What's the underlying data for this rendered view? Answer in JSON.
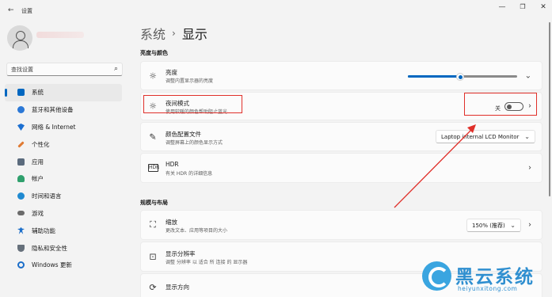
{
  "titlebar": {
    "back": "←",
    "title": "设置",
    "minimize": "—",
    "maximize": "❐",
    "close": "✕"
  },
  "sidebar": {
    "search_placeholder": "查找设置",
    "items": [
      {
        "label": "系统",
        "icon": "monitor-icon",
        "color": "#0067c0",
        "active": true
      },
      {
        "label": "蓝牙和其他设备",
        "icon": "bluetooth-icon",
        "color": "#2b78d6"
      },
      {
        "label": "网络 & Internet",
        "icon": "wifi-icon",
        "color": "#1b6fd1"
      },
      {
        "label": "个性化",
        "icon": "brush-icon",
        "color": "#e07a32"
      },
      {
        "label": "应用",
        "icon": "apps-icon",
        "color": "#5b6b7d"
      },
      {
        "label": "帐户",
        "icon": "account-icon",
        "color": "#2fa06d"
      },
      {
        "label": "时间和语言",
        "icon": "globe-icon",
        "color": "#1f8ad1"
      },
      {
        "label": "游戏",
        "icon": "gamepad-icon",
        "color": "#6b6b6b"
      },
      {
        "label": "辅助功能",
        "icon": "accessibility-icon",
        "color": "#1a6dc9"
      },
      {
        "label": "隐私和安全性",
        "icon": "shield-icon",
        "color": "#66707b"
      },
      {
        "label": "Windows 更新",
        "icon": "update-icon",
        "color": "#1a6dc9"
      }
    ]
  },
  "main": {
    "breadcrumb_parent": "系统",
    "breadcrumb_sep": "›",
    "breadcrumb_current": "显示",
    "section1": "亮度与颜色",
    "section2": "规模与布局",
    "brightness": {
      "title": "亮度",
      "subtitle": "调整内置显示器的亮度",
      "level": 0.48
    },
    "night_light": {
      "title": "夜间模式",
      "subtitle": "使用较暖的颜色帮助阻止蓝光",
      "state_label": "关"
    },
    "color_profile": {
      "title": "颜色配置文件",
      "subtitle": "调整屏幕上的颜色显示方式",
      "value": "Laptop internal LCD Monitor"
    },
    "hdr": {
      "title": "HDR",
      "subtitle": "有关 HDR 的详细信息"
    },
    "scale": {
      "title": "缩放",
      "subtitle": "更改文本、应用等项目的大小",
      "value": "150% (推荐)"
    },
    "resolution": {
      "title": "显示分辨率",
      "subtitle": "调整 分辨率 以 适合 所 连接 的 显示器"
    },
    "orientation": {
      "title": "显示方向"
    }
  },
  "watermark": {
    "text": "黑云系统",
    "url": "heiyunxitong.com"
  },
  "colors": {
    "accent": "#0067c0",
    "highlight": "#e0302a"
  }
}
